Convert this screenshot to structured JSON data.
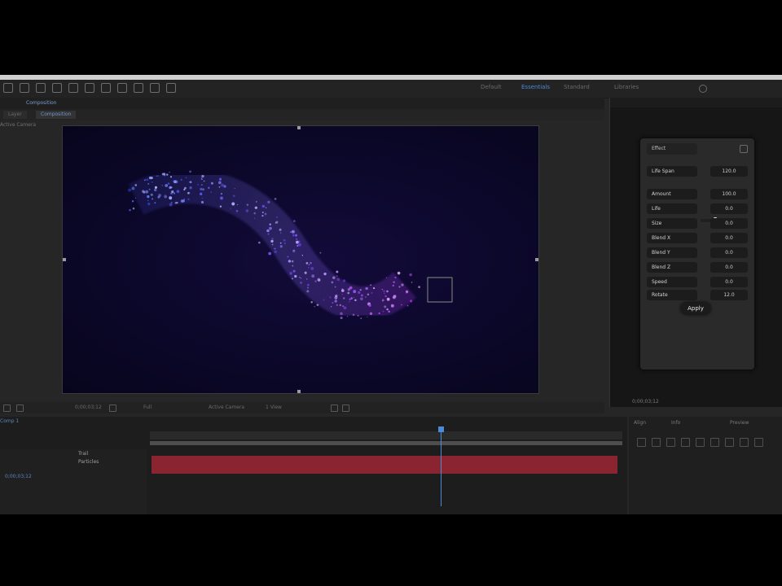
{
  "app": {
    "workspaces": [
      "Default",
      "Essentials",
      "Standard",
      "Libraries"
    ],
    "active_workspace": "Essentials"
  },
  "composition": {
    "panel_tab": "Composition",
    "sub_tabs": [
      "Layer",
      "Composition"
    ],
    "active_subtab": "Composition",
    "camera": "Active Camera"
  },
  "extension": {
    "header": "Effect",
    "rows": [
      {
        "label": "Life Span",
        "value": "120.0"
      },
      {
        "label": "Amount",
        "value": "100.0"
      },
      {
        "label": "Life",
        "value": "0.0"
      },
      {
        "label": "Size",
        "value": "0.0"
      },
      {
        "label": "Blend X",
        "value": "0.0"
      },
      {
        "label": "Blend Y",
        "value": "0.0"
      },
      {
        "label": "Blend Z",
        "value": "0.0"
      },
      {
        "label": "Speed",
        "value": "0.0"
      },
      {
        "label": "Rotate",
        "value": "12.0"
      }
    ],
    "apply_label": "Apply",
    "slider_value": 0.3
  },
  "viewer_controls": {
    "zoom": "Full",
    "resolution": "Active Camera",
    "views": "1 View",
    "time": "0;00;03;12"
  },
  "side_footer": "0;00;03;12",
  "timeline": {
    "tab": "Comp 1",
    "current_time": "0;00;03;12",
    "layers": [
      "Trail",
      "Particles"
    ],
    "playhead_fraction": 0.62
  },
  "right_bottom": {
    "labels": [
      "Align",
      "Info",
      "Preview"
    ]
  },
  "colors": {
    "accent": "#4b8ad6",
    "layer_bar": "#8b2431",
    "viewer_bg": "#0b0728",
    "particles": "#7b5cff"
  }
}
